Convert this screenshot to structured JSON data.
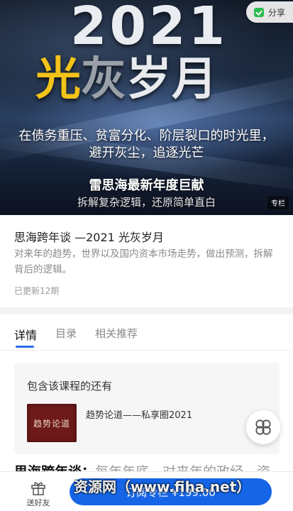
{
  "hero": {
    "year": "2021",
    "title_parts": [
      "光",
      "灰",
      "岁月"
    ],
    "tagline_line1": "在债务重压、贫富分化、阶层裂口的时光里，",
    "tagline_line2": "避开灰尘，追逐光芒",
    "author_line": "雷思海最新年度巨献",
    "subtitle": "拆解复杂逻辑，还原简单直白",
    "badge": "专栏"
  },
  "share": {
    "label": "分享",
    "icon": "wechat-share-icon"
  },
  "course": {
    "title": "思海跨年谈 —2021 光灰岁月",
    "description": "对来年的趋势，世界以及国内资本市场走势，做出预测，拆解背后的逻辑。",
    "updates": "已更新12期"
  },
  "tabs": [
    {
      "label": "详情",
      "active": true
    },
    {
      "label": "目录",
      "active": false
    },
    {
      "label": "相关推荐",
      "active": false
    }
  ],
  "related": {
    "heading": "包含该课程的还有",
    "item": {
      "name": "趋势论道——私享圈2021",
      "thumb_text": "趋势论道"
    }
  },
  "peek": {
    "bold": "思海跨年谈：",
    "rest": "每年年底，对来年的政经、资"
  },
  "bottom_bar": {
    "gift_label": "送好友",
    "subscribe_label": "订阅专栏 ¥199.00"
  },
  "watermark": "资源网（www.fiha.net）",
  "colors": {
    "accent": "#1565e6",
    "title_gold": "#f2c318",
    "thumb_red": "#6e1a1a"
  }
}
